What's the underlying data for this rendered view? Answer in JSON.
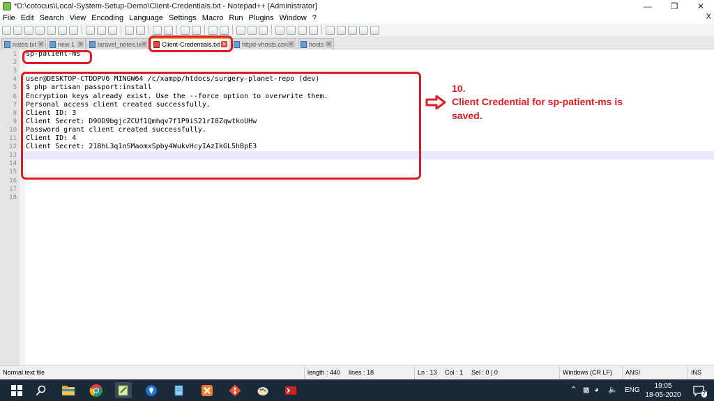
{
  "window": {
    "title": "*D:\\cotocus\\Local-System-Setup-Demo\\Client-Credentials.txt - Notepad++ [Administrator]",
    "close_menu_label": "X"
  },
  "menu": [
    "File",
    "Edit",
    "Search",
    "View",
    "Encoding",
    "Language",
    "Settings",
    "Macro",
    "Run",
    "Plugins",
    "Window",
    "?"
  ],
  "tabs": [
    {
      "label": "notes.txt",
      "active": false
    },
    {
      "label": "new 1",
      "active": false
    },
    {
      "label": "laravel_notes.txt",
      "active": false
    },
    {
      "label": "Client-Credentials.txt",
      "active": true
    },
    {
      "label": "httpd-vhosts.conf",
      "active": false
    },
    {
      "label": "hosts",
      "active": false
    }
  ],
  "editor": {
    "current_line": 13,
    "lines": [
      "sp-patient-ms",
      "",
      "",
      "user@DESKTOP-CTDDPV6 MINGW64 /c/xampp/htdocs/surgery-planet-repo (dev)",
      "$ php artisan passport:install",
      "Encryption keys already exist. Use the --force option to overwrite them.",
      "Personal access client created successfully.",
      "Client ID: 3",
      "Client Secret: D9OD9bgjcZCUf1Qmhqv7f1P9iS21rI8ZqwtkoUHw",
      "Password grant client created successfully.",
      "Client ID: 4",
      "Client Secret: 21BhL3q1nSMaomxSpby4WukvHcyIAzIkGL5hBpE3",
      "",
      "",
      "",
      "",
      "",
      ""
    ]
  },
  "annotation": {
    "number": "10.",
    "text": "Client Credential for sp-patient-ms is saved.",
    "color": "#e01b24"
  },
  "status": {
    "file_type": "Normal text file",
    "length": "length : 440",
    "lines": "lines : 18",
    "ln": "Ln : 13",
    "col": "Col : 1",
    "sel": "Sel : 0 | 0",
    "eol": "Windows (CR LF)",
    "encoding": "ANSI",
    "mode": "INS"
  },
  "taskbar": {
    "apps": [
      "start-icon",
      "search-icon",
      "file-explorer-icon",
      "chrome-icon",
      "notepadpp-icon",
      "maps-icon",
      "notepad-icon",
      "xampp-icon",
      "git-icon",
      "paint-icon",
      "terminal-icon"
    ],
    "lang": "ENG",
    "time": "19:05",
    "date": "18-05-2020",
    "notifications": "7"
  }
}
